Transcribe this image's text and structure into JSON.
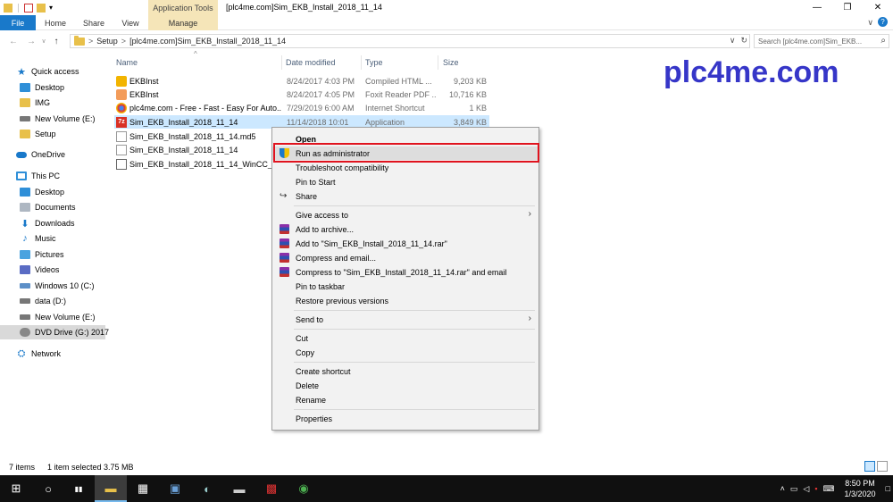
{
  "window": {
    "title": "[plc4me.com]Sim_EKB_Install_2018_11_14",
    "app_tools": "Application Tools",
    "controls": [
      "—",
      "❐",
      "✕"
    ]
  },
  "ribbon": {
    "tabs": [
      "File",
      "Home",
      "Share",
      "View",
      "Manage"
    ],
    "collapse": "∨",
    "help": "?"
  },
  "address": {
    "back": "←",
    "forward": "→",
    "recent": "∨",
    "up": "↑",
    "crumbs": [
      "Setup",
      "[plc4me.com]Sim_EKB_Install_2018_11_14"
    ],
    "crumb_sep": ">",
    "dropdown": "∨",
    "refresh": "↻",
    "search_placeholder": "Search [plc4me.com]Sim_EKB...",
    "search_icon": "⌕"
  },
  "nav": {
    "items": [
      {
        "label": "Quick access",
        "icon": "star-icon"
      },
      {
        "label": "Desktop",
        "icon": "desktop-icon"
      },
      {
        "label": "IMG",
        "icon": "folder-icon"
      },
      {
        "label": "New Volume (E:)",
        "icon": "drive-icon"
      },
      {
        "label": "Setup",
        "icon": "folder-icon"
      },
      {
        "label": "OneDrive",
        "icon": "cloud-icon"
      },
      {
        "label": "This PC",
        "icon": "pc-icon"
      },
      {
        "label": "Desktop",
        "icon": "desktop-icon"
      },
      {
        "label": "Documents",
        "icon": "documents-icon"
      },
      {
        "label": "Downloads",
        "icon": "downloads-icon"
      },
      {
        "label": "Music",
        "icon": "music-icon"
      },
      {
        "label": "Pictures",
        "icon": "pictures-icon"
      },
      {
        "label": "Videos",
        "icon": "videos-icon"
      },
      {
        "label": "Windows 10 (C:)",
        "icon": "windows-drive-icon"
      },
      {
        "label": "data (D:)",
        "icon": "drive-icon"
      },
      {
        "label": "New Volume (E:)",
        "icon": "drive-icon"
      },
      {
        "label": "DVD Drive (G:) 2017",
        "icon": "dvd-icon"
      },
      {
        "label": "Network",
        "icon": "network-icon"
      }
    ]
  },
  "columns": [
    "Name",
    "Date modified",
    "Type",
    "Size"
  ],
  "sort_arrow": "^",
  "files": [
    {
      "name": "EKBInst",
      "date": "8/24/2017 4:03 PM",
      "type": "Compiled HTML ...",
      "size": "9,203 KB",
      "icon": "chm-icon"
    },
    {
      "name": "EKBInst",
      "date": "8/24/2017 4:05 PM",
      "type": "Foxit Reader PDF ...",
      "size": "10,716 KB",
      "icon": "pdf-icon"
    },
    {
      "name": "plc4me.com - Free - Fast - Easy For Auto...",
      "date": "7/29/2019 6:00 AM",
      "type": "Internet Shortcut",
      "size": "1 KB",
      "icon": "chrome-icon"
    },
    {
      "name": "Sim_EKB_Install_2018_11_14",
      "date": "11/14/2018 10:01",
      "type": "Application",
      "size": "3,849 KB",
      "icon": "app-icon",
      "app_glyph": "7z"
    },
    {
      "name": "Sim_EKB_Install_2018_11_14.md5",
      "date": "",
      "type": "",
      "size": "",
      "icon": "document-icon"
    },
    {
      "name": "Sim_EKB_Install_2018_11_14",
      "date": "",
      "type": "",
      "size": "",
      "icon": "text-icon"
    },
    {
      "name": "Sim_EKB_Install_2018_11_14_WinCC_7.5",
      "date": "",
      "type": "",
      "size": "",
      "icon": "exe-icon"
    }
  ],
  "watermark": "plc4me.com",
  "context_menu": {
    "submenu_arrow": "›",
    "share_glyph": "↪",
    "items": [
      {
        "label": "Open",
        "bold": true
      },
      {
        "label": "Run as administrator",
        "icon": "shield-icon"
      },
      {
        "label": "Troubleshoot compatibility"
      },
      {
        "label": "Pin to Start"
      },
      {
        "label": "Share",
        "icon": "share-icon"
      },
      {
        "label": "Give access to",
        "submenu": true
      },
      {
        "label": "Add to archive...",
        "icon": "winrar-icon"
      },
      {
        "label": "Add to \"Sim_EKB_Install_2018_11_14.rar\"",
        "icon": "winrar-icon"
      },
      {
        "label": "Compress and email...",
        "icon": "winrar-icon"
      },
      {
        "label": "Compress to \"Sim_EKB_Install_2018_11_14.rar\" and email",
        "icon": "winrar-icon"
      },
      {
        "label": "Pin to taskbar"
      },
      {
        "label": "Restore previous versions"
      },
      {
        "label": "Send to",
        "submenu": true
      },
      {
        "label": "Cut"
      },
      {
        "label": "Copy"
      },
      {
        "label": "Create shortcut"
      },
      {
        "label": "Delete"
      },
      {
        "label": "Rename"
      },
      {
        "label": "Properties"
      }
    ]
  },
  "status": {
    "count": "7 items",
    "selection": "1 item selected  3.75 MB"
  },
  "taskbar": {
    "glyphs": {
      "start": "⊞",
      "search": "○",
      "task_view": "▮▮",
      "explorer": "▬",
      "store": "▦",
      "app1": "▣",
      "app2": "◐",
      "app3": "▬",
      "app4": "▩",
      "chrome": "◉",
      "tray_arrow": "˄",
      "network": "▭",
      "volume": "◁",
      "tray_flag": "▪",
      "language": "⌨",
      "notifications": "□"
    },
    "time": "8:50 PM",
    "date": "1/3/2020"
  },
  "colors": {
    "accent": "#1979ca",
    "selection": "#cce8ff",
    "highlight_box": "#e0131e",
    "watermark": "#3636c8",
    "app_tools_bg": "#f5e5b8"
  }
}
